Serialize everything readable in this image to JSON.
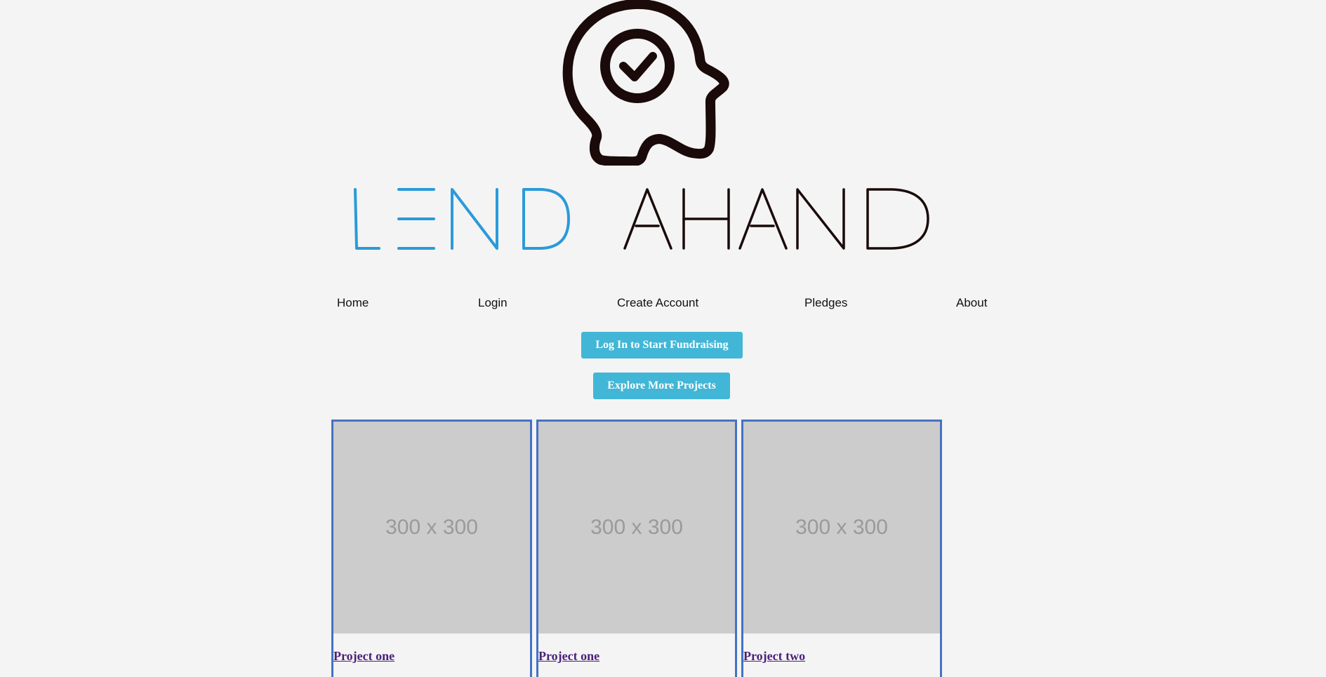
{
  "brand": {
    "logo_text_part1": "LEND",
    "logo_text_part2": "AHAND",
    "logo_colors": {
      "accent": "#2b9ad9",
      "dark": "#1a0a0a"
    },
    "head_icon": "head-with-checkmark-icon"
  },
  "nav": {
    "items": [
      {
        "label": "Home"
      },
      {
        "label": "Login"
      },
      {
        "label": "Create Account"
      },
      {
        "label": "Pledges"
      },
      {
        "label": "About"
      }
    ]
  },
  "actions": {
    "login_label": "Log In to Start Fundraising",
    "explore_label": "Explore More Projects",
    "button_color": "#42b6d6"
  },
  "projects": [
    {
      "image_placeholder": "300 x 300",
      "title": "Project one"
    },
    {
      "image_placeholder": "300 x 300",
      "title": "Project one"
    },
    {
      "image_placeholder": "300 x 300",
      "title": "Project two"
    }
  ]
}
